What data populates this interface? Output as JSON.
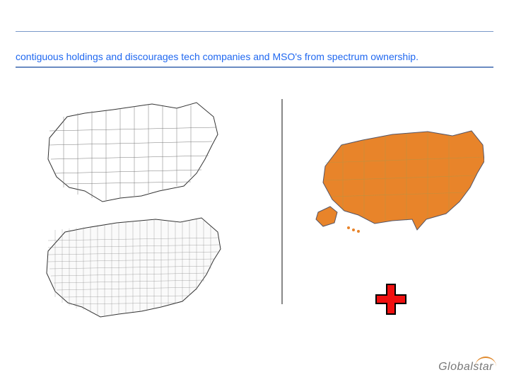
{
  "title": "contiguous holdings and discourages tech companies and MSO's from spectrum ownership.",
  "logo_text": "Globalstar",
  "maps": {
    "left_top_desc": "us-map-outline-areas",
    "left_bottom_desc": "us-map-outline-counties",
    "right_desc": "us-map-solid-orange"
  },
  "colors": {
    "accent_blue": "#2068f0",
    "rule_blue": "#7a99c9",
    "map_orange": "#e8842a",
    "plus_red": "#f01010"
  },
  "icons": {
    "plus": "plus-icon"
  }
}
